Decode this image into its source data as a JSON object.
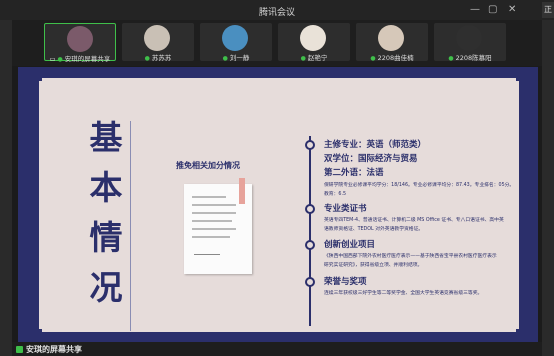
{
  "app": {
    "title": "腾讯会议",
    "corner_badge": "正"
  },
  "participants": [
    {
      "name": "安琪的屏幕共享",
      "active": true,
      "avatar_color": "#7b5a6a"
    },
    {
      "name": "苏苏苏",
      "active": false,
      "avatar_color": "#c9c0b5"
    },
    {
      "name": "刘一静",
      "active": false,
      "avatar_color": "#4a8fc0"
    },
    {
      "name": "赵艳宁",
      "active": false,
      "avatar_color": "#e9e2d8"
    },
    {
      "name": "2208曲佳楠",
      "active": false,
      "avatar_color": "#d6c8b9"
    },
    {
      "name": "2208陈慕阳",
      "active": false,
      "avatar_color": "#2f2f2f"
    }
  ],
  "slide": {
    "title_chars": [
      "基",
      "本",
      "情",
      "况"
    ],
    "subtitle": "推免相关加分情况",
    "sections": [
      {
        "title": "主修专业：英语（师范类）",
        "extra_titles": [
          "双学位：国际经济与贸易",
          "第二外语：法语"
        ],
        "lines": [
          "保研学院专业必修课平均学分：18/146。专业必修课平均分：87.43。专业排名：05分。",
          "教育：6.5"
        ]
      },
      {
        "title": "专业类证书",
        "lines": [
          "英语专四TEM-4、普通话证书、计算机二级 MS Office 证书、专八口语证书、高中英",
          "语教师资格证、TEDOL 对外英语教学资格证。"
        ]
      },
      {
        "title": "创新创业项目",
        "lines": [
          "《陕西中国西部下院外农村医疗医疗表示——基于陕西省宝平县农村医疗医疗表示",
          "研究实证研究》，获得省级立项、并顺利结项。"
        ]
      },
      {
        "title": "荣誉与奖项",
        "lines": [
          "连续三年获校级三好学生等二等奖学金、全国大学生英语竞赛省级三等奖。"
        ]
      }
    ]
  },
  "bottom_bar": {
    "label": "安琪的屏幕共享"
  }
}
